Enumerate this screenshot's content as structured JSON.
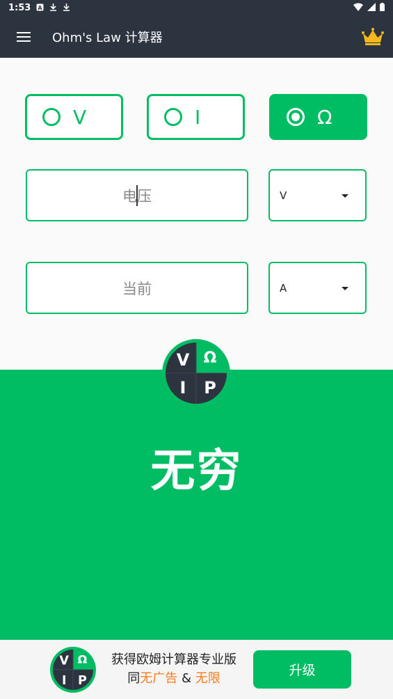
{
  "status_bar": {
    "time": "1:53"
  },
  "app_bar": {
    "title": "Ohm's Law 计算器"
  },
  "options": [
    {
      "label": "V",
      "selected": false
    },
    {
      "label": "I",
      "selected": false
    },
    {
      "label": "Ω",
      "selected": true
    }
  ],
  "inputs": [
    {
      "placeholder": "电压",
      "unit": "V"
    },
    {
      "placeholder": "当前",
      "unit": "A"
    }
  ],
  "vip_logo": {
    "q1": "V",
    "q2": "Ω",
    "q3": "I",
    "q4": "P"
  },
  "promo_panel": {
    "headline": "无穷"
  },
  "bottom_banner": {
    "line1": "获得欧姆计算器专业版",
    "line2_prefix": "同",
    "line2_highlight1": "无广告",
    "line2_amp": "&",
    "line2_highlight2": "无限",
    "upgrade_label": "升级"
  },
  "colors": {
    "brand_green": "#00bd63",
    "header_dark": "#2c3440",
    "highlight_orange": "#ff7a1a"
  }
}
